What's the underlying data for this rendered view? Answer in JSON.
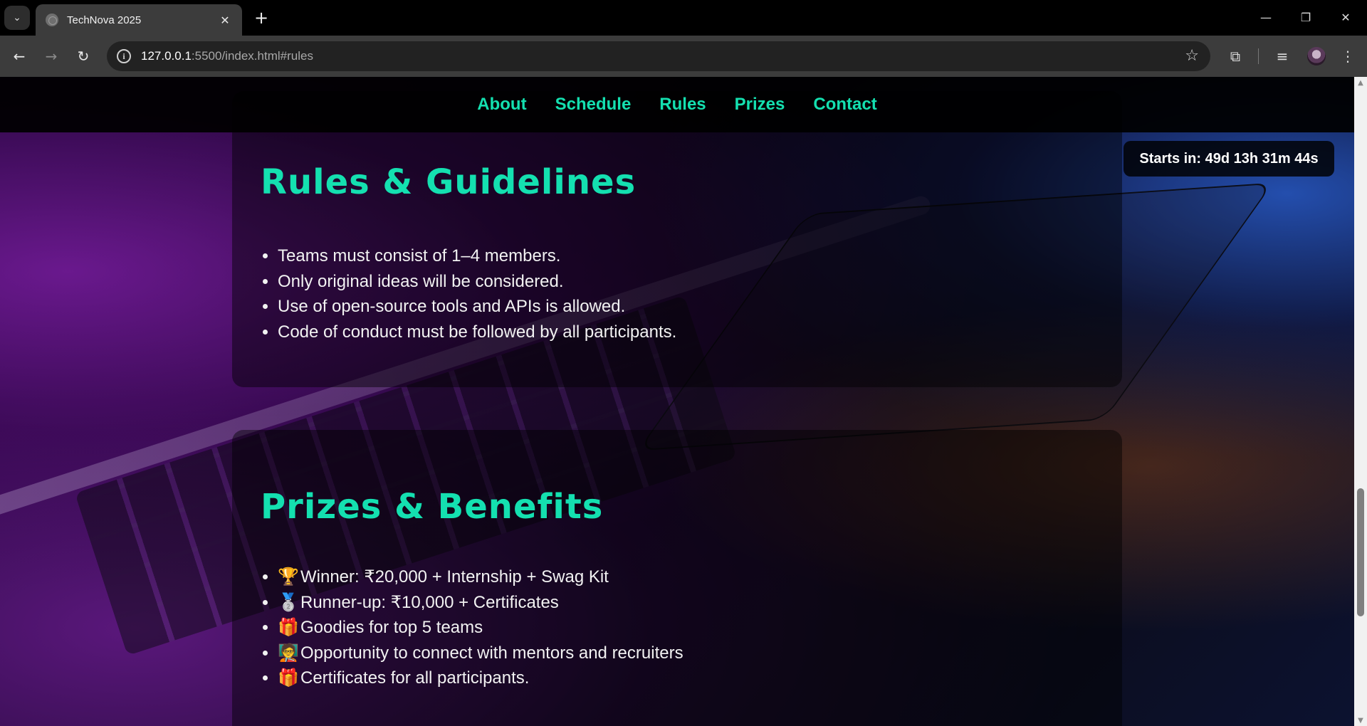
{
  "browser": {
    "tab_title": "TechNova 2025",
    "url_host": "127.0.0.1",
    "url_rest": ":5500/index.html#rules"
  },
  "site_nav": [
    "About",
    "Schedule",
    "Rules",
    "Prizes",
    "Contact"
  ],
  "countdown": "Starts in: 49d 13h 31m 44s",
  "rules": {
    "title": "Rules & Guidelines",
    "items": [
      "Teams must consist of 1–4 members.",
      "Only original ideas will be considered.",
      "Use of open-source tools and APIs is allowed.",
      "Code of conduct must be followed by all participants."
    ]
  },
  "prizes": {
    "title": "Prizes & Benefits",
    "items": [
      {
        "emoji": "🏆",
        "text": "Winner: ₹20,000 + Internship + Swag Kit"
      },
      {
        "emoji": "🥈",
        "text": "Runner-up: ₹10,000 + Certificates"
      },
      {
        "emoji": "🎁",
        "text": "Goodies for top 5 teams"
      },
      {
        "emoji": "🧑‍🏫",
        "text": "Opportunity to connect with mentors and recruiters"
      },
      {
        "emoji": "🎁",
        "text": "Certificates for all participants."
      }
    ]
  },
  "colors": {
    "accent": "#14e0b0"
  }
}
